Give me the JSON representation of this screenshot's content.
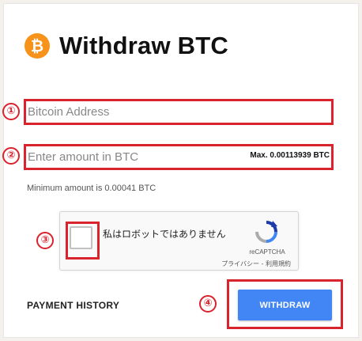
{
  "header": {
    "title": "Withdraw BTC",
    "icon": "bitcoin-icon",
    "icon_glyph": "₿",
    "icon_color": "#f7931a"
  },
  "form": {
    "address_placeholder": "Bitcoin Address",
    "address_value": "",
    "amount_placeholder": "Enter amount in BTC",
    "amount_value": "",
    "max_label": "Max. 0.00113939 BTC",
    "minimum_note": "Minimum amount is 0.00041 BTC"
  },
  "recaptcha": {
    "label": "私はロボットではありません",
    "brand": "reCAPTCHA",
    "links": "プライバシー - 利用規約",
    "checked": false
  },
  "footer": {
    "history_label": "PAYMENT HISTORY",
    "withdraw_label": "WITHDRAW"
  },
  "annotations": [
    "①",
    "②",
    "③",
    "④"
  ],
  "colors": {
    "accent": "#4285f4",
    "highlight": "#d9232d"
  }
}
